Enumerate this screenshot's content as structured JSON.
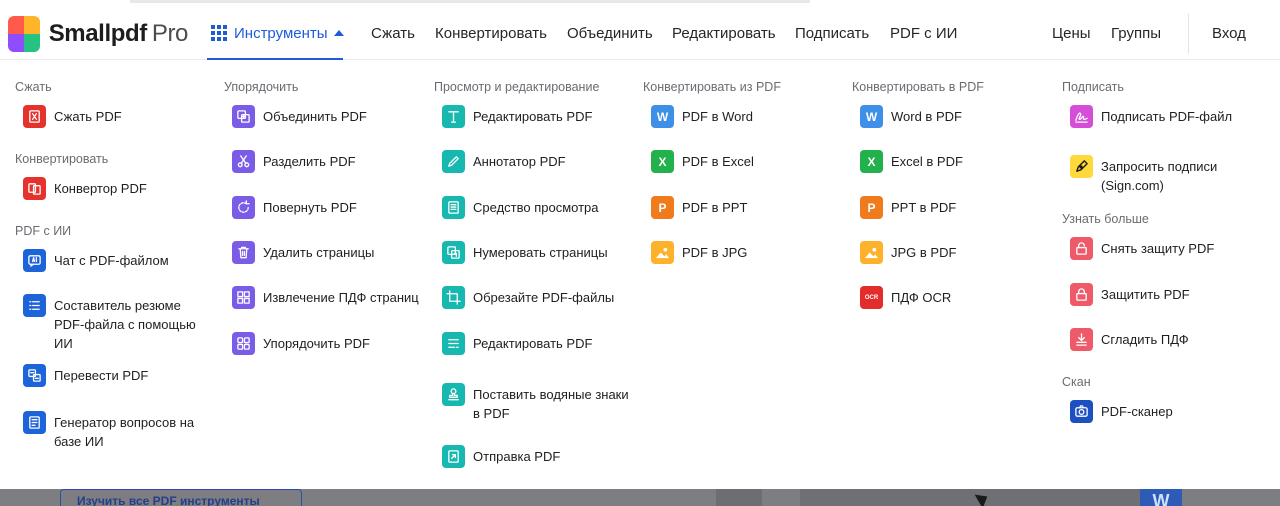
{
  "header": {
    "logo_name": "Smallpdf",
    "logo_tier": "Pro",
    "tools_label": "Инструменты",
    "links": [
      "Сжать",
      "Конвертировать",
      "Объединить",
      "Редактировать",
      "Подписать",
      "PDF с ИИ"
    ],
    "right_links": [
      "Цены",
      "Группы"
    ],
    "login": "Вход"
  },
  "columns": [
    {
      "sections": [
        {
          "title": "Сжать",
          "items": [
            {
              "label": "Сжать PDF",
              "icon": "compress-icon",
              "color": "#e5322d"
            }
          ]
        },
        {
          "title": "Конвертировать",
          "items": [
            {
              "label": "Конвертор PDF",
              "icon": "convert-icon",
              "color": "#e5322d"
            }
          ]
        },
        {
          "title": "PDF с ИИ",
          "items": [
            {
              "label": "Чат с PDF-файлом",
              "icon": "ai-chat-icon",
              "color": "#1d63d9"
            },
            {
              "label": "Составитель резюме PDF-файла с помощью ИИ",
              "icon": "list-icon",
              "color": "#1d63d9"
            },
            {
              "label": "Перевести PDF",
              "icon": "translate-icon",
              "color": "#1d63d9"
            },
            {
              "label": "Генератор вопросов на базе ИИ",
              "icon": "question-doc-icon",
              "color": "#1d63d9"
            }
          ]
        }
      ]
    },
    {
      "sections": [
        {
          "title": "Упорядочить",
          "items": [
            {
              "label": "Объединить PDF",
              "icon": "merge-icon",
              "color": "#7b5ce6"
            },
            {
              "label": "Разделить PDF",
              "icon": "scissors-icon",
              "color": "#7b5ce6"
            },
            {
              "label": "Повернуть PDF",
              "icon": "rotate-icon",
              "color": "#7b5ce6"
            },
            {
              "label": "Удалить страницы",
              "icon": "trash-icon",
              "color": "#7b5ce6"
            },
            {
              "label": "Извлечение ПДФ страниц",
              "icon": "extract-icon",
              "color": "#7b5ce6"
            },
            {
              "label": "Упорядочить PDF",
              "icon": "organize-icon",
              "color": "#7b5ce6"
            }
          ]
        }
      ]
    },
    {
      "sections": [
        {
          "title": "Просмотр и редактирование",
          "items": [
            {
              "label": "Редактировать PDF",
              "icon": "text-edit-icon",
              "color": "#17b8b0"
            },
            {
              "label": "Аннотатор PDF",
              "icon": "pen-icon",
              "color": "#17b8b0"
            },
            {
              "label": "Средство просмотра",
              "icon": "viewer-icon",
              "color": "#17b8b0"
            },
            {
              "label": "Нумеровать страницы",
              "icon": "numbering-icon",
              "color": "#17b8b0"
            },
            {
              "label": "Обрезайте PDF-файлы",
              "icon": "crop-icon",
              "color": "#17b8b0"
            },
            {
              "label": "Редактировать PDF",
              "icon": "form-icon",
              "color": "#17b8b0"
            },
            {
              "label": "Поставить водяные знаки в PDF",
              "icon": "watermark-icon",
              "color": "#17b8b0"
            },
            {
              "label": "Отправка PDF",
              "icon": "send-icon",
              "color": "#17b8b0"
            }
          ]
        }
      ]
    },
    {
      "sections": [
        {
          "title": "Конвертировать из PDF",
          "items": [
            {
              "label": "PDF в Word",
              "icon": "word-icon",
              "glyph": "W",
              "color": "#3d8fe8"
            },
            {
              "label": "PDF в Excel",
              "icon": "excel-icon",
              "glyph": "X",
              "color": "#22b14c"
            },
            {
              "label": "PDF в PPT",
              "icon": "ppt-icon",
              "glyph": "P",
              "color": "#f07b1d"
            },
            {
              "label": "PDF в JPG",
              "icon": "jpg-icon",
              "color": "#ffb12a"
            }
          ]
        }
      ]
    },
    {
      "sections": [
        {
          "title": "Конвертировать в PDF",
          "items": [
            {
              "label": "Word в PDF",
              "icon": "word-icon",
              "glyph": "W",
              "color": "#3d8fe8"
            },
            {
              "label": "Excel в PDF",
              "icon": "excel-icon",
              "glyph": "X",
              "color": "#22b14c"
            },
            {
              "label": "PPT в PDF",
              "icon": "ppt-icon",
              "glyph": "P",
              "color": "#f07b1d"
            },
            {
              "label": "JPG в PDF",
              "icon": "jpg-icon",
              "color": "#ffb12a"
            },
            {
              "label": "ПДФ OCR",
              "icon": "ocr-icon",
              "glyph": "OCR",
              "color": "#e32d2d"
            }
          ]
        }
      ]
    },
    {
      "sections": [
        {
          "title": "Подписать",
          "items": [
            {
              "label": "Подписать PDF-файл",
              "icon": "signature-icon",
              "color": "#d44ed8"
            },
            {
              "label": "Запросить подписи (Sign.com)",
              "icon": "sign-pen-icon",
              "color": "#ffd93a"
            }
          ]
        },
        {
          "title": "Узнать больше",
          "items": [
            {
              "label": "Снять защиту PDF",
              "icon": "unlock-icon",
              "color": "#ee5a6a"
            },
            {
              "label": "Защитить PDF",
              "icon": "lock-icon",
              "color": "#ee5a6a"
            },
            {
              "label": "Сгладить ПДФ",
              "icon": "flatten-icon",
              "color": "#ee5a6a"
            }
          ]
        },
        {
          "title": "Скан",
          "items": [
            {
              "label": "PDF-сканер",
              "icon": "camera-icon",
              "color": "#1c4fbf"
            }
          ]
        }
      ]
    }
  ],
  "background": {
    "button_label": "Изучить все PDF инструменты"
  }
}
